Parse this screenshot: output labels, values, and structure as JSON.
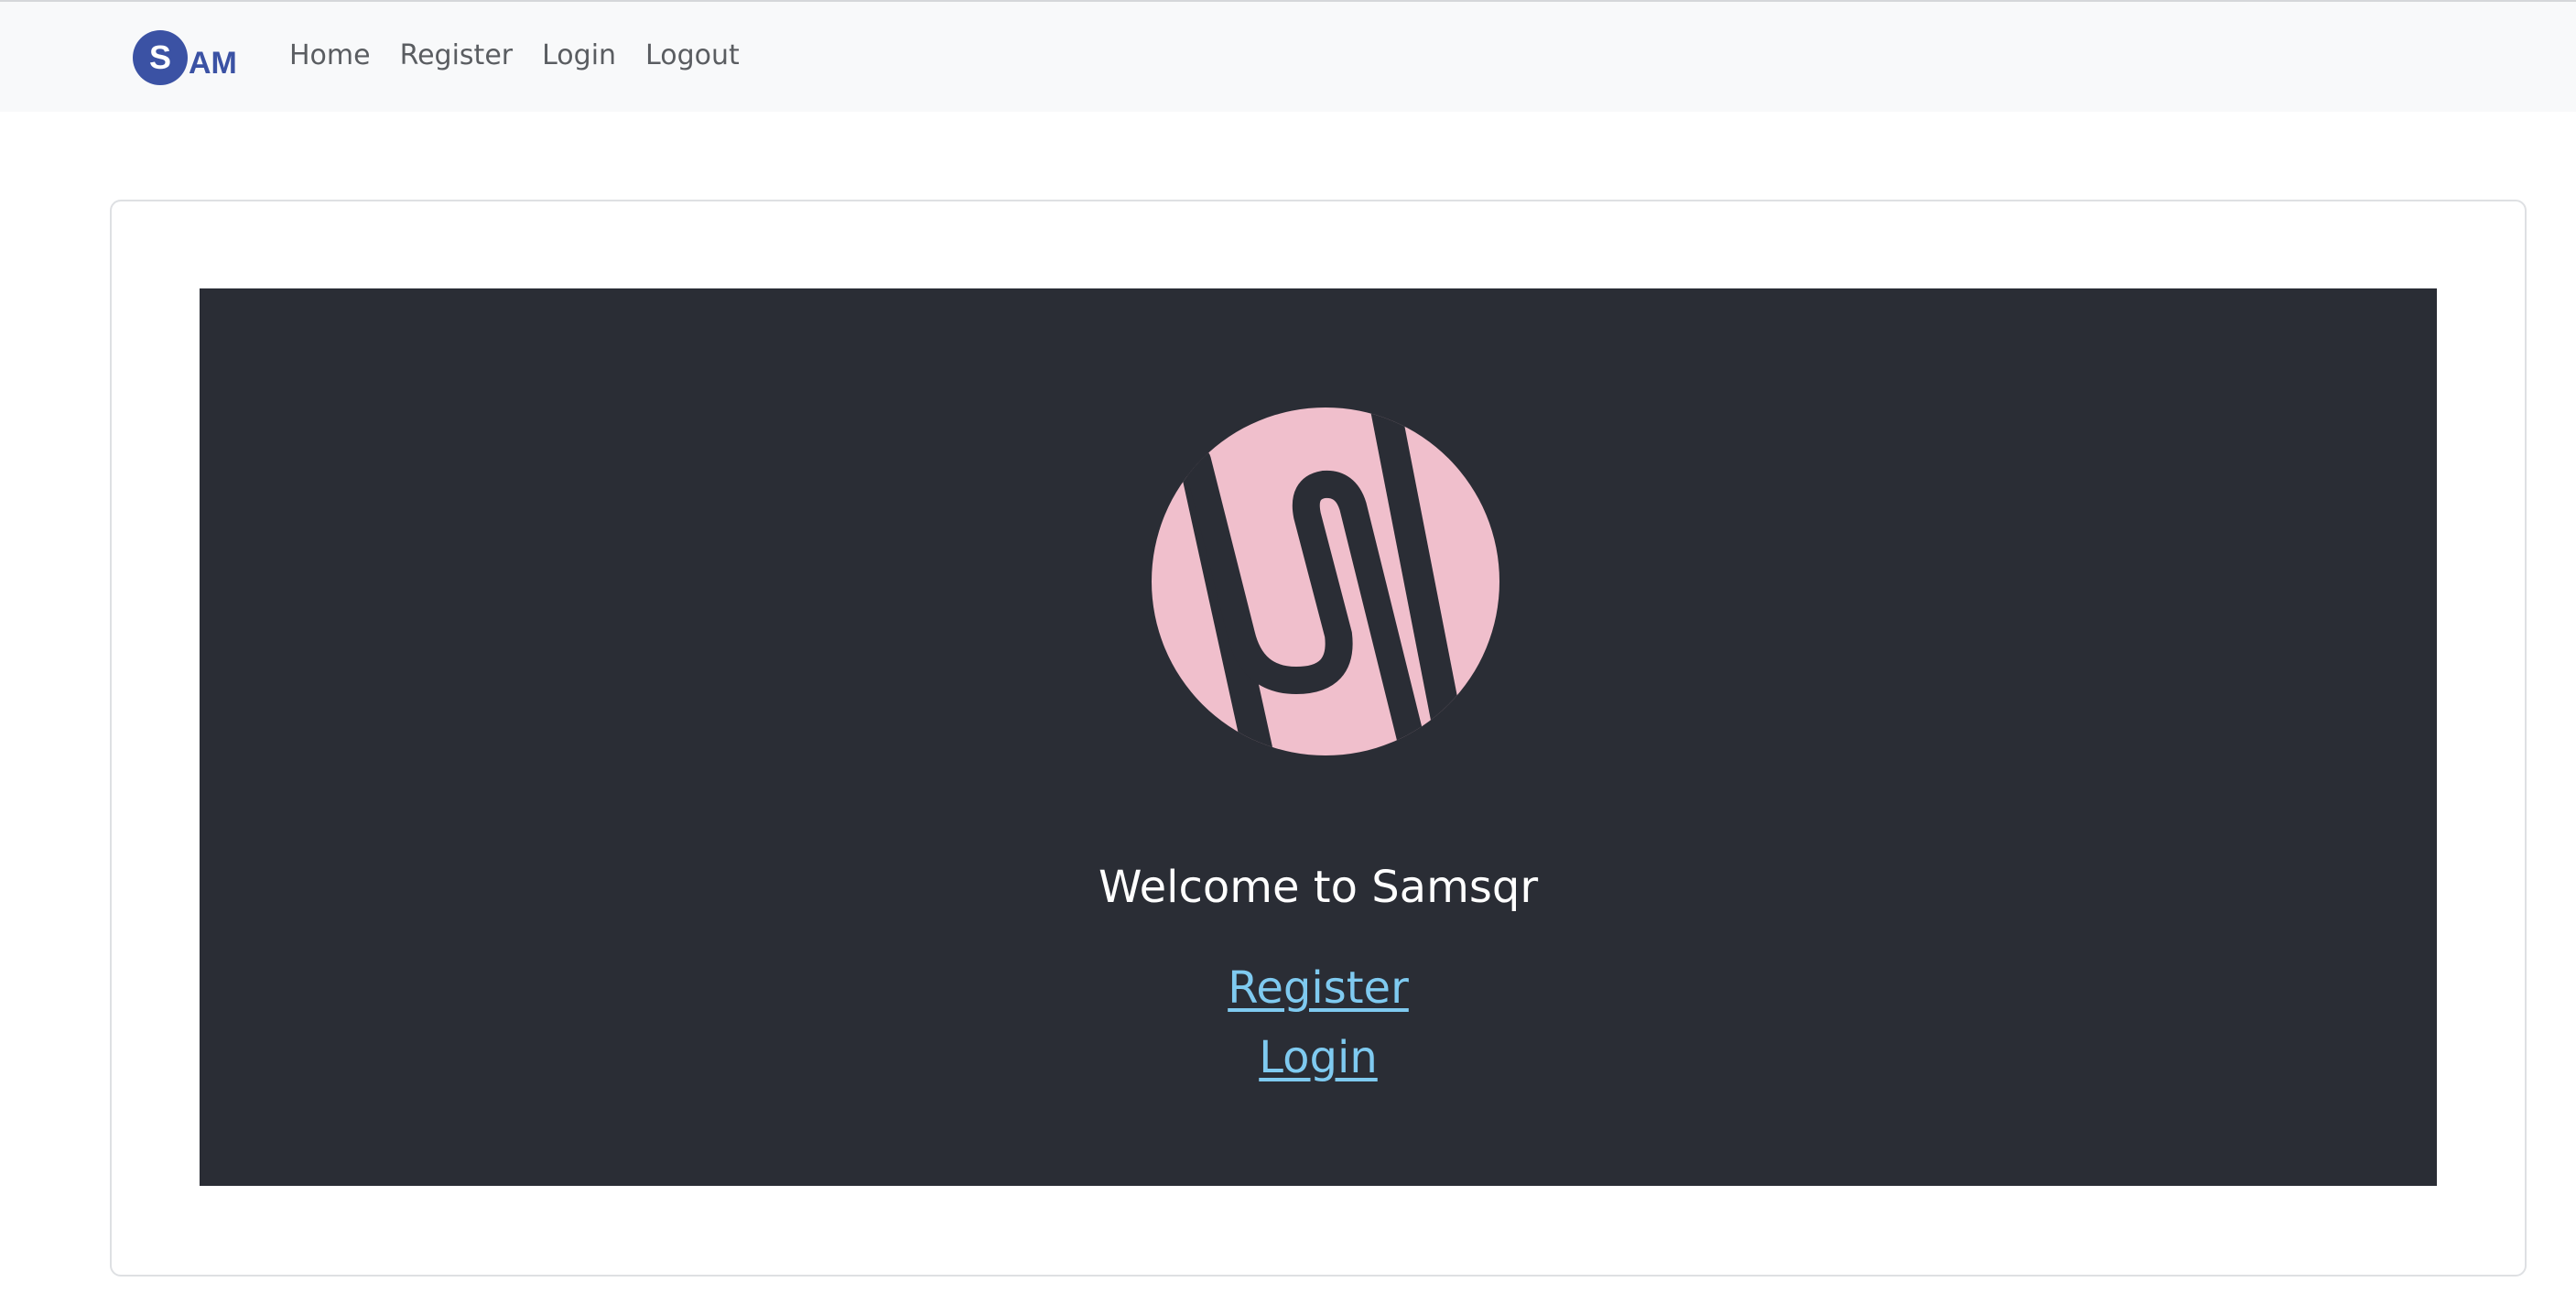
{
  "brand": {
    "logo_letter": "S",
    "logo_text": "AM",
    "color": "#3b52a4"
  },
  "nav": {
    "items": [
      {
        "label": "Home"
      },
      {
        "label": "Register"
      },
      {
        "label": "Login"
      },
      {
        "label": "Logout"
      }
    ]
  },
  "hero": {
    "logo_icon": "samsqr-s-logo-icon",
    "welcome": "Welcome to Samsqr",
    "register_link": "Register",
    "login_link": "Login",
    "background": "#2a2d35",
    "logo_color": "#f0bfcc",
    "link_color": "#7fcaf0"
  }
}
